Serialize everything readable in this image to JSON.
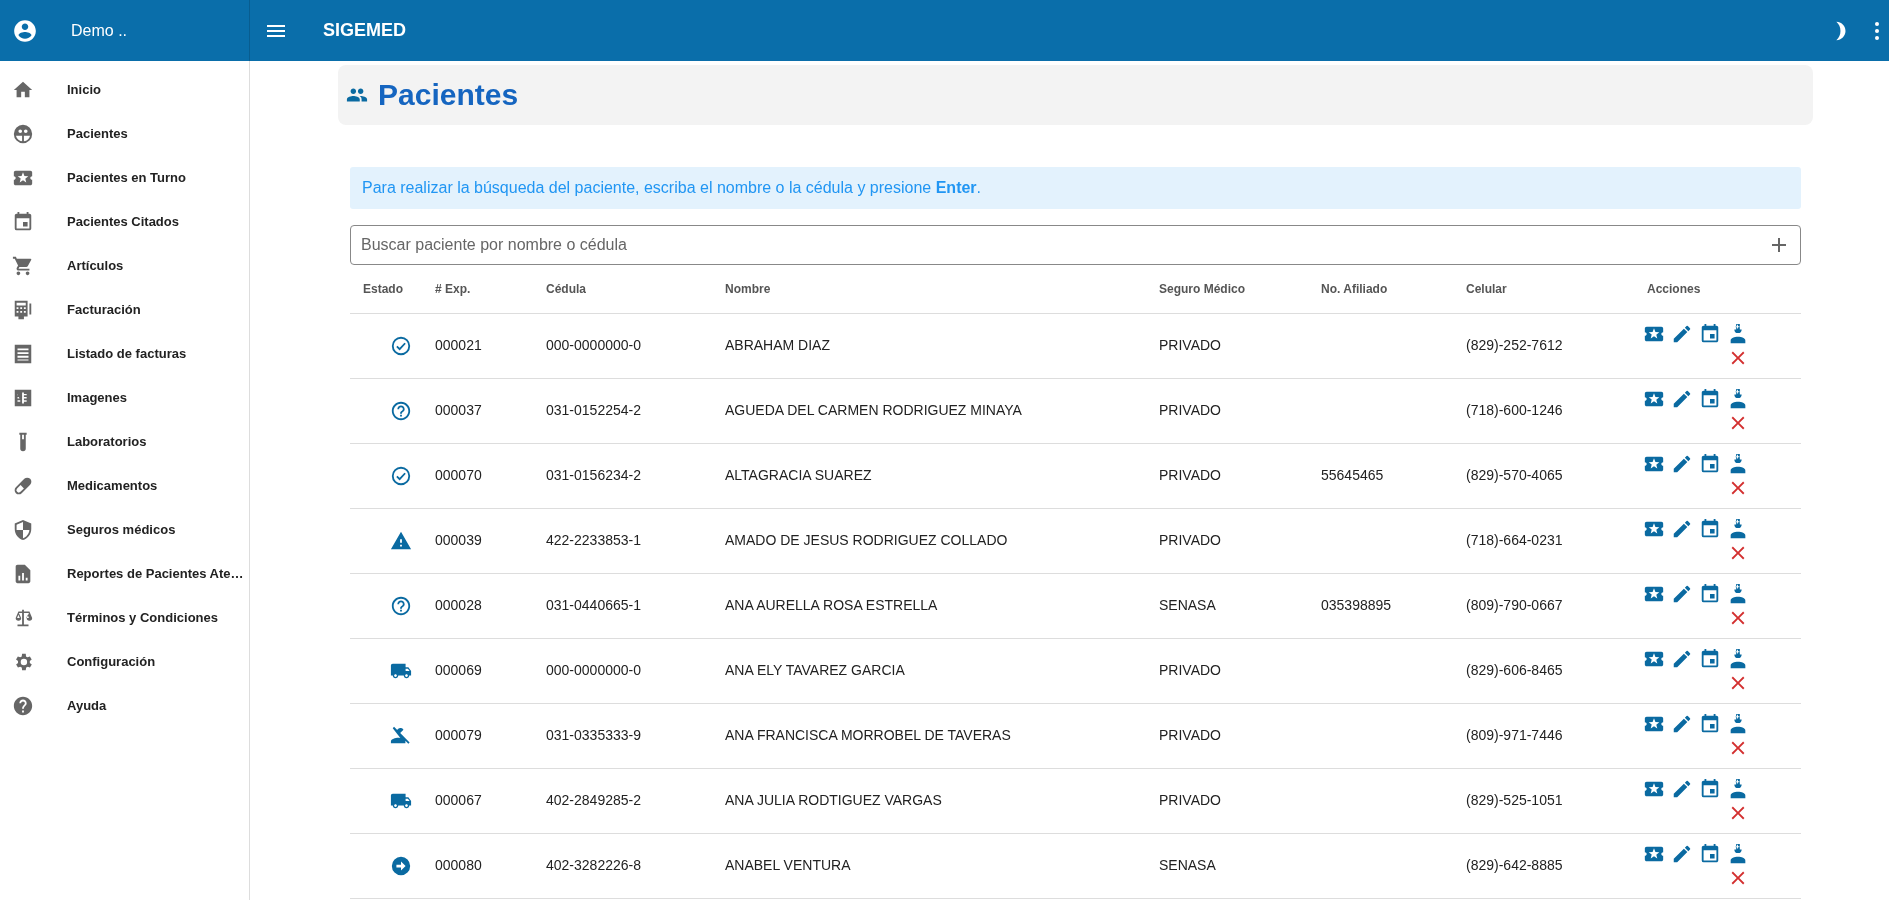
{
  "user": {
    "name": "Demo .."
  },
  "app_title": "SIGEMED",
  "sidebar": {
    "items": [
      {
        "label": "Inicio"
      },
      {
        "label": "Pacientes"
      },
      {
        "label": "Pacientes en Turno"
      },
      {
        "label": "Pacientes Citados"
      },
      {
        "label": "Artículos"
      },
      {
        "label": "Facturación"
      },
      {
        "label": "Listado de facturas"
      },
      {
        "label": "Imagenes"
      },
      {
        "label": "Laboratorios"
      },
      {
        "label": "Medicamentos"
      },
      {
        "label": "Seguros médicos"
      },
      {
        "label": "Reportes de Pacientes Ate…"
      },
      {
        "label": "Términos y Condiciones"
      },
      {
        "label": "Configuración"
      },
      {
        "label": "Ayuda"
      }
    ]
  },
  "page_title": "Pacientes",
  "info_alert": "Para realizar la búsqueda del paciente, escriba el nombre o la cédula y presione **Enter**.",
  "search": {
    "placeholder": "Buscar paciente por nombre o cédula"
  },
  "table": {
    "columns": [
      "Estado",
      "# Exp.",
      "Cédula",
      "Nombre",
      "Seguro Médico",
      "No. Afiliado",
      "Celular",
      "Acciones"
    ],
    "rows": [
      {
        "kind": "check",
        "exp": "000021",
        "cedula": "000-0000000-0",
        "nombre": "ABRAHAM DIAZ",
        "seguro": "PRIVADO",
        "celular": "(829)-252-7612"
      },
      {
        "kind": "question",
        "exp": "000037",
        "cedula": "031-0152254-2",
        "nombre": "AGUEDA DEL CARMEN RODRIGUEZ MINAYA",
        "seguro": "PRIVADO",
        "celular": "(718)-600-1246"
      },
      {
        "kind": "check",
        "exp": "000070",
        "cedula": "031-0156234-2",
        "nombre": "ALTAGRACIA SUAREZ",
        "seguro": "PRIVADO",
        "afiliado": "55645465",
        "celular": "(829)-570-4065"
      },
      {
        "kind": "warning",
        "exp": "000039",
        "cedula": "422-2233853-1",
        "nombre": "AMADO DE JESUS RODRIGUEZ COLLADO",
        "seguro": "PRIVADO",
        "celular": "(718)-664-0231"
      },
      {
        "kind": "question",
        "exp": "000028",
        "cedula": "031-0440665-1",
        "nombre": "ANA AURELLA ROSA ESTRELLA",
        "seguro": "SENASA",
        "afiliado": "035398895",
        "celular": "(809)-790-0667"
      },
      {
        "kind": "truck",
        "exp": "000069",
        "cedula": "000-0000000-0",
        "nombre": "ANA ELY TAVAREZ GARCIA",
        "seguro": "PRIVADO",
        "celular": "(829)-606-8465"
      },
      {
        "kind": "person_off",
        "exp": "000079",
        "cedula": "031-0335333-9",
        "nombre": "ANA FRANCISCA MORROBEL DE TAVERAS",
        "seguro": "PRIVADO",
        "celular": "(809)-971-7446"
      },
      {
        "kind": "truck",
        "exp": "000067",
        "cedula": "402-2849285-2",
        "nombre": "ANA JULIA RODTIGUEZ VARGAS",
        "seguro": "PRIVADO",
        "celular": "(829)-525-1051"
      },
      {
        "kind": "arrow",
        "exp": "000080",
        "cedula": "402-3282226-8",
        "nombre": "ANABEL VENTURA",
        "seguro": "SENASA",
        "celular": "(829)-642-8885"
      }
    ]
  }
}
